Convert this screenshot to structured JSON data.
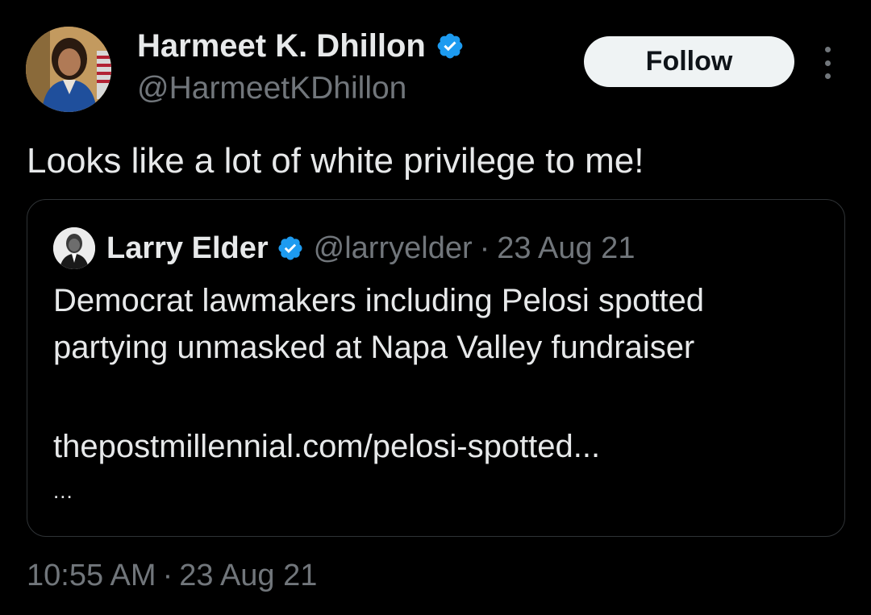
{
  "colors": {
    "background": "#000000",
    "primary_text": "#e7e9ea",
    "secondary_text": "#71767b",
    "verified_blue": "#1d9bf0",
    "follow_button_bg": "#eff3f4",
    "card_border": "#2f3336"
  },
  "author": {
    "display_name": "Harmeet K. Dhillon",
    "handle": "@HarmeetKDhillon",
    "verified_icon": "verified-badge-icon",
    "avatar_icon": "profile-photo"
  },
  "actions": {
    "follow_label": "Follow",
    "more_icon": "more-options-icon"
  },
  "tweet": {
    "text": "Looks like a lot of white privilege to me!",
    "time": "10:55 AM",
    "separator": "·",
    "date": "23 Aug 21"
  },
  "quoted": {
    "display_name": "Larry Elder",
    "handle": "@larryelder",
    "separator": "·",
    "date": "23 Aug 21",
    "body_line1": "Democrat lawmakers including Pelosi spotted",
    "body_line2": "partying unmasked at Napa Valley fundraiser",
    "link": "thepostmillennial.com/pelosi-spotted...",
    "truncation": "..."
  }
}
